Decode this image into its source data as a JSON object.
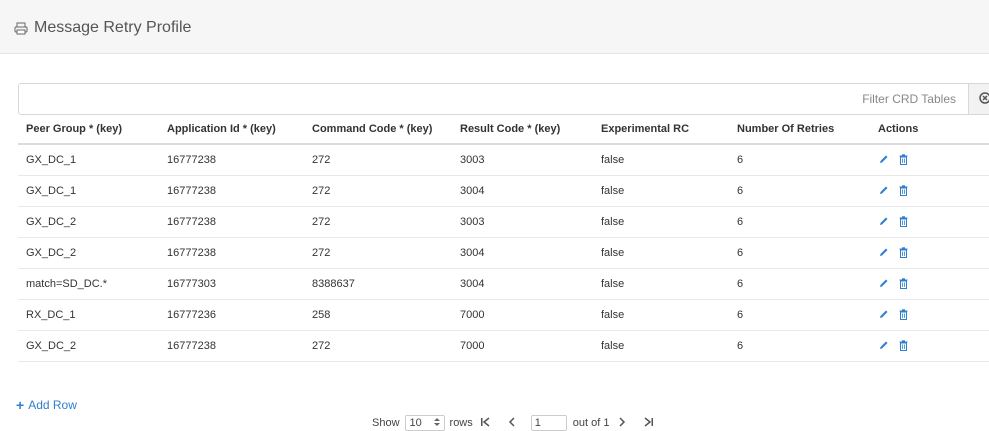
{
  "header": {
    "title": "Message Retry Profile"
  },
  "filter": {
    "placeholder": "Filter CRD Tables"
  },
  "table": {
    "columns": [
      "Peer Group * (key)",
      "Application Id * (key)",
      "Command Code * (key)",
      "Result Code * (key)",
      "Experimental RC",
      "Number Of Retries",
      "Actions"
    ],
    "rows": [
      [
        "GX_DC_1",
        "16777238",
        "272",
        "3003",
        "false",
        "6"
      ],
      [
        "GX_DC_1",
        "16777238",
        "272",
        "3004",
        "false",
        "6"
      ],
      [
        "GX_DC_2",
        "16777238",
        "272",
        "3003",
        "false",
        "6"
      ],
      [
        "GX_DC_2",
        "16777238",
        "272",
        "3004",
        "false",
        "6"
      ],
      [
        "match=SD_DC.*",
        "16777303",
        "8388637",
        "3004",
        "false",
        "6"
      ],
      [
        "RX_DC_1",
        "16777236",
        "258",
        "7000",
        "false",
        "6"
      ],
      [
        "GX_DC_2",
        "16777238",
        "272",
        "7000",
        "false",
        "6"
      ]
    ]
  },
  "add_row": {
    "label": "Add Row"
  },
  "pagination": {
    "show_label": "Show",
    "page_size": "10",
    "rows_label": "rows",
    "current_page": "1",
    "out_of_label": "out of 1"
  },
  "icons": [
    "printer-icon",
    "clear-filter-icon",
    "edit-icon",
    "delete-icon",
    "first-page-icon",
    "prev-page-icon",
    "next-page-icon",
    "last-page-icon"
  ],
  "colors": {
    "accent": "#2f7fd0"
  }
}
